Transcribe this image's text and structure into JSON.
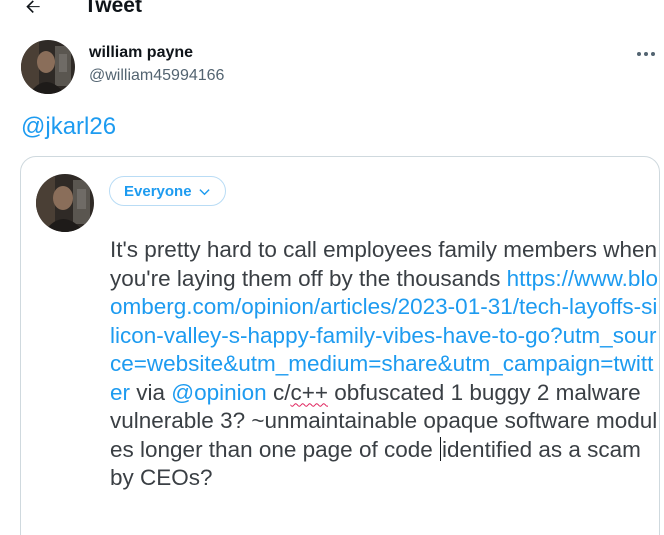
{
  "header": {
    "title": "Tweet",
    "back_icon": "arrow-left-icon"
  },
  "author": {
    "name": "william payne",
    "handle": "@william45994166",
    "more_icon": "more-dots-icon"
  },
  "mention": "@jkarl26",
  "composer": {
    "audience_label": "Everyone",
    "audience_icon": "chevron-down-icon",
    "text": {
      "part1": "It's pretty hard to call employees family members when you're laying them off by the thousands ",
      "link": "https://www.bloomberg.com/opinion/articles/2023-01-31/tech-layoffs-silicon-valley-s-happy-family-vibes-have-to-go?utm_source=website&utm_medium=share&utm_campaign=twitter",
      "part2": " via ",
      "mention": "@opinion",
      "part3": " c/",
      "misspelled": "c++",
      "part4": " obfuscated 1 buggy 2 malware vulnerable 3? ~unmaintainable opaque software modules longer than one page of code",
      "part5": "identified as a scam by CEOs?"
    }
  },
  "colors": {
    "accent": "#1d9bf0",
    "text": "#0f1419",
    "secondary": "#536471",
    "border": "#cfd9de"
  }
}
